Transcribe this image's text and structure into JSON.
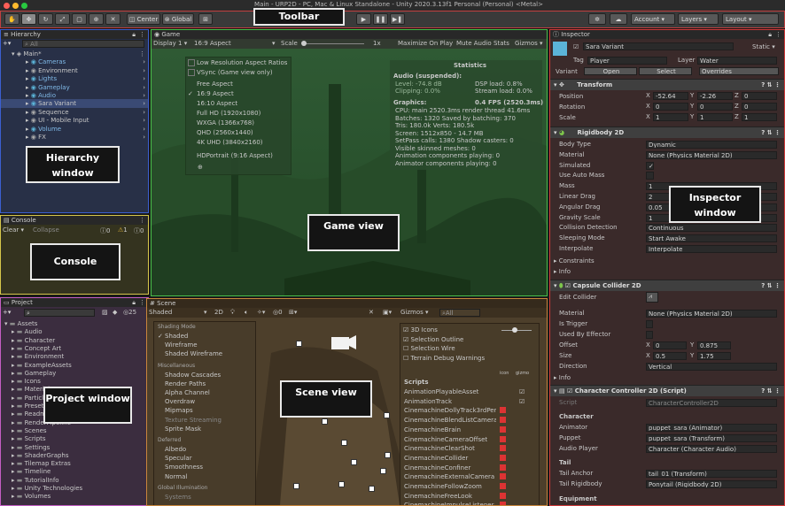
{
  "window_title": "Main - URP2D - PC, Mac & Linux Standalone - Unity 2020.3.13f1 Personal (Personal) <Metal>",
  "toolbar": {
    "pivot_label": "Center",
    "space_label": "Global",
    "account_label": "Account",
    "layers_label": "Layers",
    "layout_label": "Layout"
  },
  "callouts": {
    "toolbar": "Toolbar",
    "hierarchy": "Hierarchy window",
    "console": "Console",
    "project": "Project window",
    "game": "Game view",
    "scene": "Scene view",
    "inspector": "Inspector window"
  },
  "hierarchy": {
    "tab": "Hierarchy",
    "search_placeholder": "All",
    "root": "Main*",
    "items": [
      "Cameras",
      "Environment",
      "Lights",
      "Gameplay",
      "Audio",
      "Sara Variant",
      "Sequence",
      "UI - Mobile Input",
      "Volume",
      "FX"
    ]
  },
  "console": {
    "tab": "Console",
    "clear": "Clear",
    "collapse": "Collapse",
    "count_info": "0",
    "count_warn": "1",
    "count_error": "0"
  },
  "project": {
    "tab": "Project",
    "count": "25",
    "root": "Assets",
    "items": [
      "Audio",
      "Character",
      "Concept Art",
      "Environment",
      "ExampleAssets",
      "Gameplay",
      "Icons",
      "Materials",
      "ParticleSystems",
      "Presets",
      "Readme",
      "RenderPipeline",
      "Scenes",
      "Scripts",
      "Settings",
      "ShaderGraphs",
      "Tilemap Extras",
      "Timeline",
      "TutorialInfo",
      "Unity Technologies",
      "Volumes"
    ]
  },
  "game": {
    "tab": "Game",
    "display": "Display 1",
    "aspect": "16:9 Aspect",
    "scale_label": "Scale",
    "scale_value": "1x",
    "maximize": "Maximize On Play",
    "mute": "Mute Audio",
    "stats": "Stats",
    "gizmos": "Gizmos",
    "aspect_menu": [
      "Low Resolution Aspect Ratios",
      "VSync (Game view only)",
      "Free Aspect",
      "16:9 Aspect",
      "16:10 Aspect",
      "Full HD (1920x1080)",
      "WXGA (1366x768)",
      "QHD (2560x1440)",
      "4K UHD (3840x2160)",
      "HDPortrait (9:16 Aspect)"
    ],
    "stats_panel": {
      "title": "Statistics",
      "audio_header": "Audio (suspended):",
      "level": "Level: -74.8 dB",
      "clipping": "Clipping: 0.0%",
      "dsp": "DSP load: 0.8%",
      "stream": "Stream load: 0.0%",
      "graphics_header": "Graphics:",
      "fps": "0.4 FPS (2520.3ms)",
      "lines": [
        "CPU: main 2520.3ms  render thread 41.6ms",
        "Batches: 1320   Saved by batching: 370",
        "Tris: 180.0k      Verts: 180.5k",
        "Screen: 1512x850 - 14.7 MB",
        "SetPass calls: 1380     Shadow casters: 0",
        "Visible skinned meshes: 0",
        "Animation components playing: 0",
        "Animator components playing: 0"
      ]
    }
  },
  "scene": {
    "tab": "Scene",
    "shading": "Shaded",
    "mode_2d": "2D",
    "gizmos": "Gizmos",
    "search_placeholder": "All",
    "shading_menu": {
      "h1": "Shading Mode",
      "items1": [
        "Shaded",
        "Wireframe",
        "Shaded Wireframe"
      ],
      "h2": "Miscellaneous",
      "items2": [
        "Shadow Cascades",
        "Render Paths",
        "Alpha Channel",
        "Overdraw",
        "Mipmaps",
        "Texture Streaming",
        "Sprite Mask"
      ],
      "h3": "Deferred",
      "items3": [
        "Albedo",
        "Specular",
        "Smoothness",
        "Normal"
      ],
      "h4": "Global Illumination",
      "items4": [
        "Systems"
      ]
    },
    "gizmos_menu": {
      "options": [
        "3D Icons",
        "Selection Outline",
        "Selection Wire",
        "Terrain Debug Warnings"
      ],
      "scripts_header": "Scripts",
      "col_icon": "icon",
      "col_gizmo": "gizmo",
      "scripts": [
        "AnimationPlayableAsset",
        "AnimationTrack",
        "CinemachineDollyTrack3rdPersonAim",
        "CinemachineBlendListCamera",
        "CinemachineBrain",
        "CinemachineCameraOffset",
        "CinemachineClearShot",
        "CinemachineCollider",
        "CinemachineConfiner",
        "CinemachineExternalCamera",
        "CinemachineFollowZoom",
        "CinemachineFreeLook",
        "CinemachineImpulseListener"
      ]
    }
  },
  "inspector": {
    "tab": "Inspector",
    "object_name": "Sara Variant",
    "static_label": "Static",
    "tag_label": "Tag",
    "tag_value": "Player",
    "layer_label": "Layer",
    "layer_value": "Water",
    "prefab_label": "Variant",
    "open": "Open",
    "select": "Select",
    "overrides": "Overrides",
    "transform": {
      "title": "Transform",
      "position": "Position",
      "rotation": "Rotation",
      "scale": "Scale",
      "pos": [
        "-52.64",
        "-2.26",
        "0"
      ],
      "rot": [
        "0",
        "0",
        "0"
      ],
      "scl": [
        "1",
        "1",
        "1"
      ]
    },
    "rigidbody": {
      "title": "Rigidbody 2D",
      "rows": [
        {
          "label": "Body Type",
          "value": "Dynamic"
        },
        {
          "label": "Material",
          "value": "None (Physics Material 2D)"
        },
        {
          "label": "Simulated",
          "value": "✓"
        },
        {
          "label": "Use Auto Mass",
          "value": ""
        },
        {
          "label": "Mass",
          "value": "1"
        },
        {
          "label": "Linear Drag",
          "value": "2"
        },
        {
          "label": "Angular Drag",
          "value": "0.05"
        },
        {
          "label": "Gravity Scale",
          "value": "1"
        },
        {
          "label": "Collision Detection",
          "value": "Continuous"
        },
        {
          "label": "Sleeping Mode",
          "value": "Start Awake"
        },
        {
          "label": "Interpolate",
          "value": "Interpolate"
        }
      ],
      "constraints": "Constraints",
      "info": "Info"
    },
    "capsule": {
      "title": "Capsule Collider 2D",
      "edit_collider": "Edit Collider",
      "material_label": "Material",
      "material_value": "None (Physics Material 2D)",
      "is_trigger": "Is Trigger",
      "used_by_effector": "Used By Effector",
      "offset": "Offset",
      "offset_x": "0",
      "offset_y": "0.875",
      "size": "Size",
      "size_x": "0.5",
      "size_y": "1.75",
      "direction": "Direction",
      "direction_value": "Vertical",
      "info": "Info"
    },
    "controller": {
      "title": "Character Controller 2D (Script)",
      "script_label": "Script",
      "script_value": "CharacterController2D",
      "character_header": "Character",
      "animator_label": "Animator",
      "animator_value": "puppet_sara (Animator)",
      "puppet_label": "Puppet",
      "puppet_value": "puppet_sara (Transform)",
      "audio_label": "Audio Player",
      "audio_value": "Character (Character Audio)",
      "tail_header": "Tail",
      "tail_anchor_label": "Tail Anchor",
      "tail_anchor_value": "tail_01 (Transform)",
      "tail_rb_label": "Tail Rigidbody",
      "tail_rb_value": "Ponytail (Rigidbody 2D)",
      "equipment_header": "Equipment"
    }
  },
  "colors": {
    "hierarchy_border": "#3b5fd0",
    "console_border": "#d6c64a",
    "project_border": "#c45ec4",
    "game_border": "#49c04a",
    "scene_border": "#c9863c",
    "inspector_border": "#d03a3a",
    "toolbar_border": "#c04040"
  }
}
